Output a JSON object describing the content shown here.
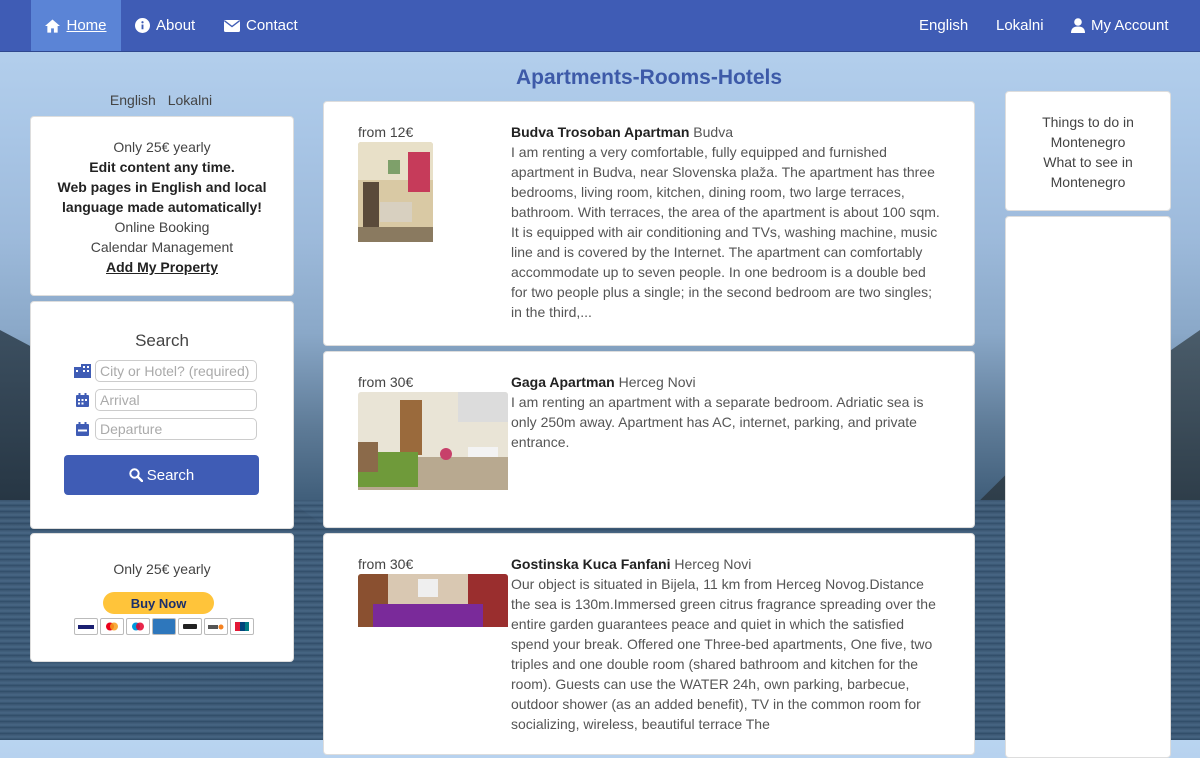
{
  "nav": {
    "home": "Home",
    "about": "About",
    "contact": "Contact",
    "english": "English",
    "lokalni": "Lokalni",
    "account": "My Account"
  },
  "page_title": "Apartments-Rooms-Hotels",
  "lang_switch": {
    "english": "English",
    "lokalni": "Lokalni"
  },
  "promo": {
    "price": "Only 25€ yearly",
    "line1": "Edit content any time.",
    "line2": "Web pages in English and local language made automatically!",
    "line3": "Online Booking",
    "line4": "Calendar Management",
    "link": "Add My Property"
  },
  "search": {
    "title": "Search",
    "city_placeholder": "City or Hotel? (required)",
    "arrival_placeholder": "Arrival",
    "departure_placeholder": "Departure",
    "button": "Search"
  },
  "pay": {
    "price": "Only 25€ yearly",
    "button": "Buy Now"
  },
  "listings": [
    {
      "from": "from 12€",
      "name": "Budva Trosoban Apartman",
      "city": "Budva",
      "desc": "I am renting a very comfortable, fully equipped and furnished apartment in Budva, near Slovenska plaža. The apartment has three bedrooms, living room, kitchen, dining room, two large terraces, bathroom. With terraces, the area of the apartment is about 100 sqm. It is equipped with air conditioning and TVs, washing machine, music line and is covered by the Internet. The apartment can comfortably accommodate up to seven people. In one bedroom is a double bed for two people plus a single; in the second bedroom are two singles; in the third,..."
    },
    {
      "from": "from 30€",
      "name": "Gaga Apartman",
      "city": "Herceg Novi",
      "desc": "I am renting an apartment with a separate bedroom. Adriatic sea is only 250m away. Apartment has AC, internet, parking, and private entrance."
    },
    {
      "from": "from 30€",
      "name": "Gostinska Kuca Fanfani",
      "city": "Herceg Novi",
      "desc": "Our object is situated in Bijela, 11 km from Herceg Novog.Distance the sea is 130m.Immersed green citrus fragrance spreading over the entire garden guarantees peace and quiet in which the satisfied spend your break. Offered one Three-bed apartments, One five, two triples and one double room (shared bathroom and kitchen for the room). Guests can use the WATER 24h, own parking, barbecue, outdoor shower (as an added benefit), TV in the common room for socializing, wireless, beautiful terrace The"
    }
  ],
  "sidebar_right": {
    "link1": "Things to do in Montenegro",
    "link2": "What to see in Montenegro"
  }
}
